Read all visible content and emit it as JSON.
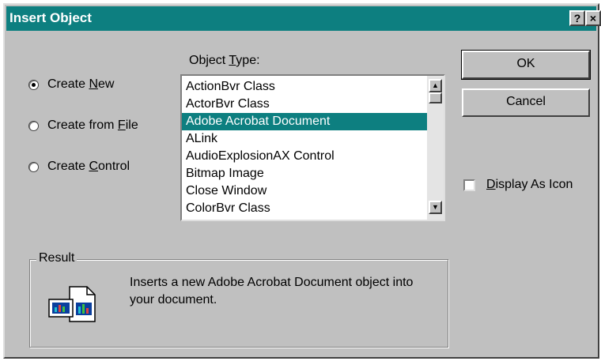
{
  "dialog": {
    "title": "Insert Object",
    "help_button": "?",
    "close_button": "×"
  },
  "radios": [
    {
      "pre": "Create ",
      "key": "N",
      "post": "ew",
      "checked": true
    },
    {
      "pre": "Create from ",
      "key": "F",
      "post": "ile",
      "checked": false
    },
    {
      "pre": "Create ",
      "key": "C",
      "post": "ontrol",
      "checked": false
    }
  ],
  "object_type": {
    "label_pre": "Object ",
    "label_key": "T",
    "label_post": "ype:",
    "items": [
      "ActionBvr Class",
      "ActorBvr Class",
      "Adobe Acrobat Document",
      "ALink",
      "AudioExplosionAX Control",
      "Bitmap Image",
      "Close Window",
      "ColorBvr Class"
    ],
    "selected_index": 2
  },
  "buttons": {
    "ok": "OK",
    "cancel": "Cancel"
  },
  "display_as_icon": {
    "key": "D",
    "post": "isplay As Icon",
    "checked": false
  },
  "result": {
    "legend": "Result",
    "text": "Inserts a new Adobe Acrobat Document object into your document."
  },
  "colors": {
    "title_bar": "#0d7f80",
    "dialog_face": "#c0c0c0",
    "selection": "#0d7f80"
  }
}
